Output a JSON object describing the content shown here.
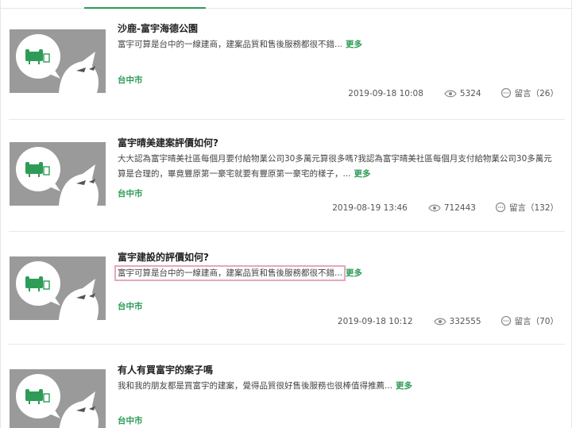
{
  "articles": [
    {
      "title": "沙鹿-富宇海德公園",
      "summary": "富宇可算是台中的一線建商，建案品質和售後服務都很不錯...",
      "more": "更多",
      "location": "台中市",
      "date": "2019-09-18 10:08",
      "views": "5324",
      "comments": "留言（26）"
    },
    {
      "title": "富宇晴美建案評價如何?",
      "summary": "大大認為富宇晴美社區每個月要付給物業公司30多萬元算很多嗎?我認為富宇晴美社區每個月支付給物業公司30多萬元算是合理的，畢竟豐原第一豪宅就要有豐原第一豪宅的樣子，...",
      "more": "更多",
      "location": "台中市",
      "date": "2019-08-19 13:46",
      "views": "712443",
      "comments": "留言（132）"
    },
    {
      "title": "富宇建設的評價如何?",
      "summary": "富宇可算是台中的一線建商，建案品質和售後服務都很不錯...",
      "more": "更多",
      "location": "台中市",
      "date": "2019-09-18 10:12",
      "views": "332555",
      "comments": "留言（70）"
    },
    {
      "title": "有人有買富宇的案子嗎",
      "summary": "我和我的朋友都是買富宇的建案，覺得品質很好售後服務也很棒值得推薦...",
      "more": "更多",
      "location": "台中市"
    }
  ],
  "colors": {
    "accent": "#2e9c57",
    "highlight": "#e8a7be",
    "thumb_bg": "#9a9a9a"
  },
  "icons": {
    "views": "eye-icon",
    "comments": "speech-bubble-icon",
    "thumb": "mascot-placeholder-icon"
  }
}
